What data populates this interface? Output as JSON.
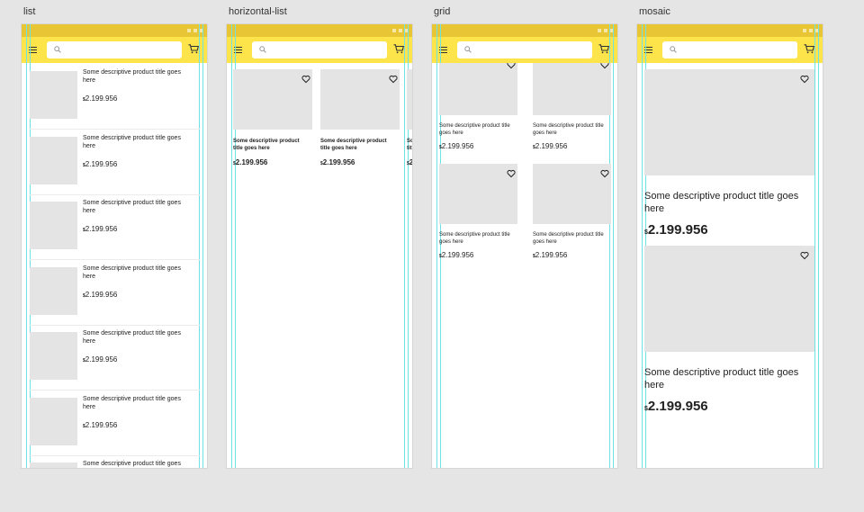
{
  "frames": {
    "list": {
      "label": "list"
    },
    "horizontal": {
      "label": "horizontal-list"
    },
    "grid": {
      "label": "grid"
    },
    "mosaic": {
      "label": "mosaic"
    }
  },
  "search": {
    "placeholder": ""
  },
  "product": {
    "title": "Some descriptive product title goes here",
    "currency": "$",
    "price": "2.199.956"
  },
  "icons": {
    "menu": "hamburger-icon",
    "search": "search-icon",
    "cart": "cart-icon",
    "favorite": "heart-icon"
  },
  "colors": {
    "statusbar": "#e8c535",
    "navbar": "#fce44a",
    "placeholder_image": "#e4e4e4",
    "guides": "#6fe3e3"
  },
  "list_count": 7,
  "horizontal_count": 3,
  "grid_count": 4,
  "mosaic_count": 2
}
